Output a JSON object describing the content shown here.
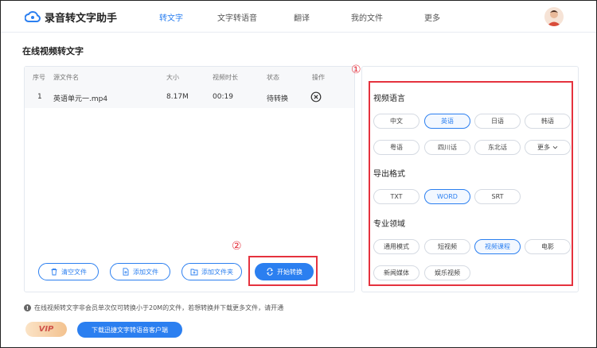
{
  "header": {
    "app_name": "录音转文字助手",
    "nav": [
      "转文字",
      "文字转语音",
      "翻译",
      "我的文件",
      "更多"
    ],
    "active_nav": 0
  },
  "page": {
    "title": "在线视频转文字"
  },
  "file_table": {
    "headers": [
      "序号",
      "源文件名",
      "大小",
      "视频时长",
      "状态",
      "操作"
    ],
    "rows": [
      {
        "index": "1",
        "name": "英语单元一.mp4",
        "size": "8.17M",
        "duration": "00:19",
        "status": "待转换"
      }
    ]
  },
  "actions": {
    "clear": "清空文件",
    "add_file": "添加文件",
    "add_folder": "添加文件夹",
    "start": "开始转换"
  },
  "annotations": {
    "mark1": "①",
    "mark2": "②",
    "color": "#e5323e"
  },
  "options": {
    "language_title": "视频语言",
    "languages": [
      "中文",
      "英语",
      "日语",
      "韩语",
      "粤语",
      "四川话",
      "东北话",
      "更多"
    ],
    "selected_language": "英语",
    "format_title": "导出格式",
    "formats": [
      "TXT",
      "WORD",
      "SRT"
    ],
    "selected_format": "WORD",
    "domain_title": "专业领域",
    "domains": [
      "通用模式",
      "短视频",
      "视频课程",
      "电影",
      "新闻媒体",
      "娱乐视频"
    ],
    "selected_domain": "视频课程"
  },
  "footer": {
    "notice": "在线视频转文字非会员单次仅可转换小于20M的文件，若想转换并下载更多文件，请开通",
    "vip": "VIP",
    "download": "下载迅捷文字转语音客户端"
  },
  "colors": {
    "accent": "#2b7ff0",
    "red": "#e5323e"
  },
  "icons": [
    "cloud-logo-icon",
    "close-circle-icon",
    "trash-icon",
    "file-add-icon",
    "folder-add-icon",
    "convert-icon",
    "chevron-down-icon",
    "info-icon"
  ]
}
